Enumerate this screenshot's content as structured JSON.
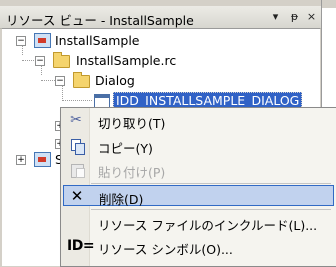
{
  "window": {
    "title": "リソース ビュー - InstallSample",
    "dropdown_glyph": "▾",
    "pin_glyph": "ᵽ",
    "close_glyph": "×"
  },
  "tree": {
    "root_label": "InstallSample",
    "rc_label": "InstallSample.rc",
    "dialog_folder_label": "Dialog",
    "dialog_item_label": "IDD_INSTALLSAMPLE_DIALOG",
    "sibling_label_partial": "S"
  },
  "context_menu": {
    "items": [
      {
        "label": "切り取り(T)",
        "icon": "scissors-icon",
        "enabled": true
      },
      {
        "label": "コピー(Y)",
        "icon": "copy-icon",
        "enabled": true
      },
      {
        "label": "貼り付け(P)",
        "icon": "paste-icon",
        "enabled": false
      },
      {
        "label": "削除(D)",
        "icon": "delete-x-icon",
        "enabled": true,
        "highlighted": true
      },
      {
        "label": "リソース ファイルのインクルード(L)...",
        "icon": "",
        "enabled": true
      },
      {
        "label": "リソース シンボル(O)...",
        "icon": "id-symbol-icon",
        "enabled": true
      }
    ],
    "id_icon_text": "ID=",
    "delete_glyph": "✕"
  },
  "colors": {
    "selection": "#3162c6",
    "menu_highlight": "#c1d2ee",
    "menu_highlight_border": "#316ac5"
  }
}
